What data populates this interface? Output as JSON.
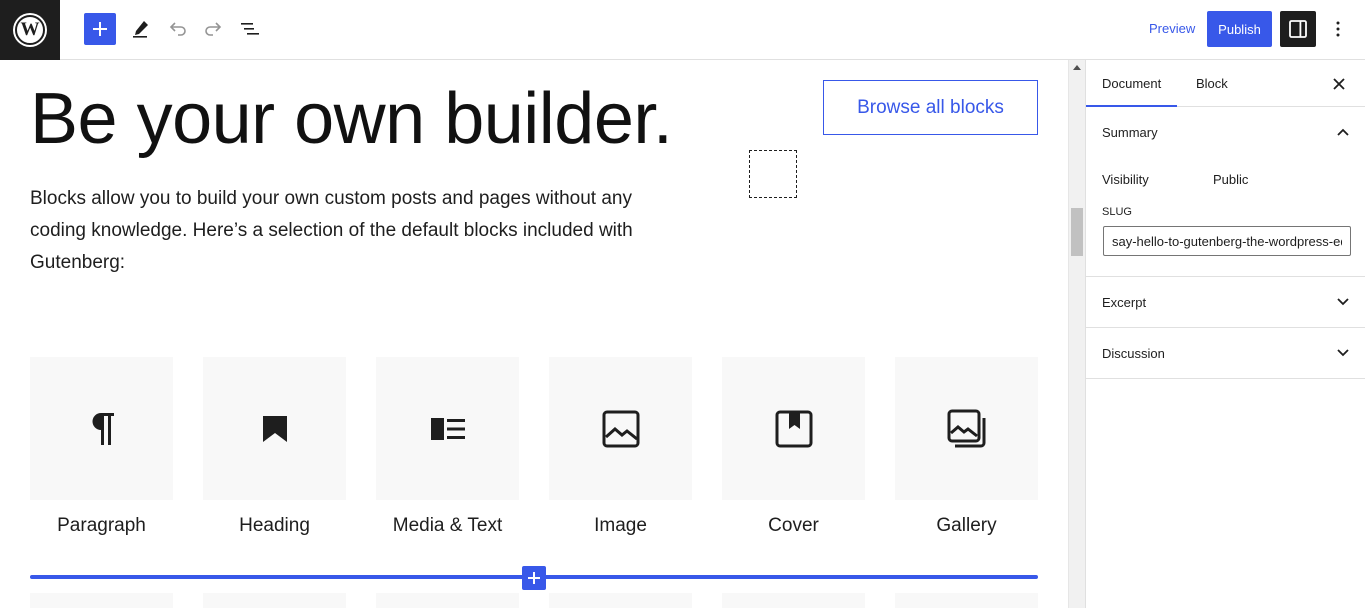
{
  "toolbar": {
    "preview_label": "Preview",
    "publish_label": "Publish",
    "accent": "#3858e9",
    "dark": "#1e1e1e"
  },
  "editor": {
    "title": "Be your own builder.",
    "browse_label": "Browse all blocks",
    "intro": "Blocks allow you to build your own custom posts and pages without any coding knowledge. Here’s a selection of the default blocks included with Gutenberg:",
    "blocks": [
      {
        "label": "Paragraph",
        "icon": "paragraph-icon"
      },
      {
        "label": "Heading",
        "icon": "bookmark-icon"
      },
      {
        "label": "Media & Text",
        "icon": "media-text-icon"
      },
      {
        "label": "Image",
        "icon": "image-icon"
      },
      {
        "label": "Cover",
        "icon": "cover-icon"
      },
      {
        "label": "Gallery",
        "icon": "gallery-icon"
      }
    ]
  },
  "sidebar": {
    "tabs": [
      {
        "label": "Document"
      },
      {
        "label": "Block"
      }
    ],
    "summary": {
      "title": "Summary",
      "visibility_label": "Visibility",
      "visibility_value": "Public",
      "slug_label": "SLUG",
      "slug_value": "say-hello-to-gutenberg-the-wordpress-editor"
    },
    "panels": [
      {
        "title": "Excerpt"
      },
      {
        "title": "Discussion"
      }
    ]
  }
}
